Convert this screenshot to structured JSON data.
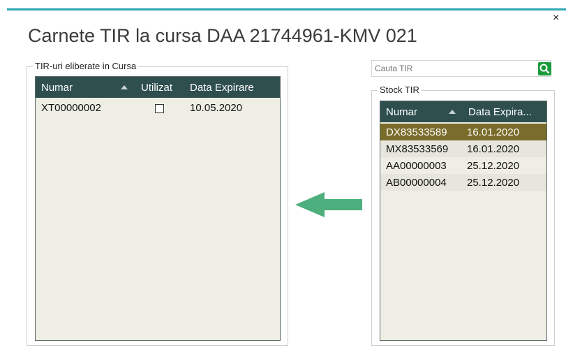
{
  "dialog": {
    "title": "Carnete TIR la cursa DAA 21744961-KMV 021",
    "close_label": "×"
  },
  "released": {
    "group_label": "TIR-uri eliberate in Cursa",
    "columns": [
      "Numar",
      "Utilizat",
      "Data Expirare"
    ],
    "rows": [
      {
        "numar": "XT00000002",
        "utilizat": false,
        "data_expirare": "10.05.2020"
      }
    ]
  },
  "search": {
    "placeholder": "Cauta TIR",
    "icon": "search-icon",
    "button_color": "#1a9a3a"
  },
  "stock": {
    "group_label": "Stock TIR",
    "columns": [
      "Numar",
      "Data Expira..."
    ],
    "rows": [
      {
        "numar": "DX83533589",
        "data_expirare": "16.01.2020",
        "selected": true
      },
      {
        "numar": "MX83533569",
        "data_expirare": "16.01.2020",
        "selected": false
      },
      {
        "numar": "AA00000003",
        "data_expirare": "25.12.2020",
        "selected": false
      },
      {
        "numar": "AB00000004",
        "data_expirare": "25.12.2020",
        "selected": false
      }
    ]
  },
  "transfer": {
    "icon": "arrow-left-icon",
    "color": "#4caf7d"
  },
  "colors": {
    "accent": "#2aa7b3",
    "grid_header": "#2f4f4f",
    "grid_background": "#eeeee4",
    "selected_row": "#7a6c2a"
  }
}
